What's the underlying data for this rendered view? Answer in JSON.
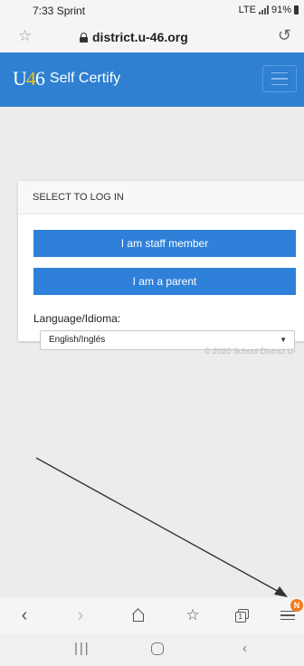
{
  "status_bar": {
    "time": "7:33",
    "carrier": "Sprint",
    "network": "LTE",
    "battery": "91%"
  },
  "browser": {
    "url": "district.u-46.org"
  },
  "site": {
    "logo_mark": "U46",
    "title": "Self Certify"
  },
  "login_card": {
    "header": "SELECT TO LOG IN",
    "staff_button": "I am staff member",
    "parent_button": "I am a parent",
    "language_label": "Language/Idioma:",
    "language_selected": "English/Inglés"
  },
  "footer": {
    "copyright": "© 2020 School District U-"
  },
  "toolbar": {
    "tabs_count": "1",
    "menu_badge": "N"
  },
  "colors": {
    "navbar": "#2f80d1",
    "button": "#2f80d9",
    "badge": "#f07c1e",
    "logo_accent": "#f3c316"
  },
  "icons": [
    "star-icon",
    "lock-icon",
    "reload-icon",
    "hamburger-icon",
    "back-icon",
    "forward-icon",
    "home-icon",
    "bookmarks-icon",
    "tabs-icon",
    "menu-icon",
    "recent-apps-icon",
    "android-home-icon",
    "android-back-icon"
  ]
}
